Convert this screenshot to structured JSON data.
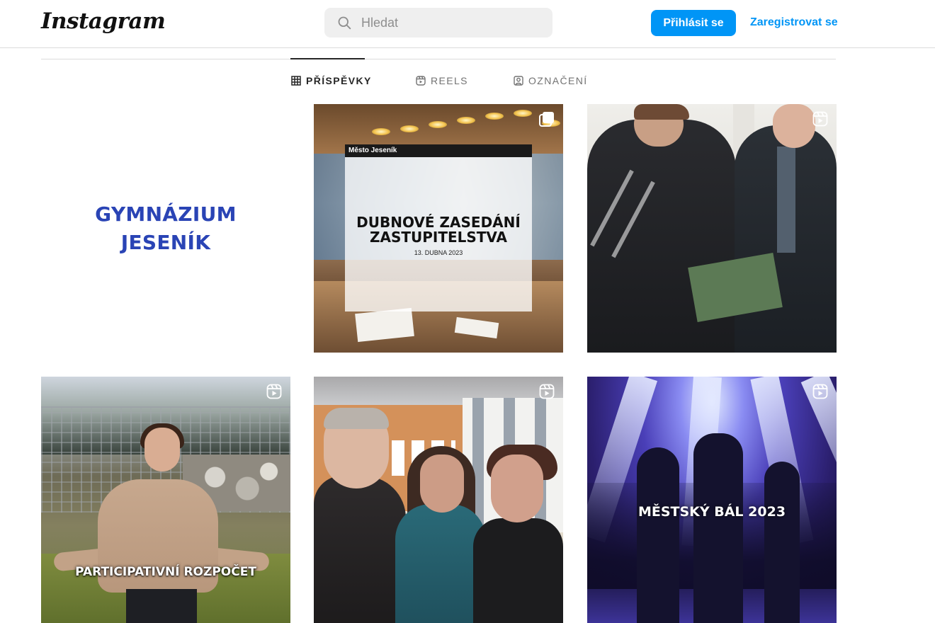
{
  "header": {
    "logo_text": "Instagram",
    "search_placeholder": "Hledat",
    "login_label": "Přihlásit se",
    "signup_label": "Zaregistrovat se"
  },
  "tabs": [
    {
      "label": "PŘÍSPĚVKY",
      "icon": "grid-icon",
      "active": true
    },
    {
      "label": "REELS",
      "icon": "reels-icon",
      "active": false
    },
    {
      "label": "OZNAČENÍ",
      "icon": "tagged-icon",
      "active": false
    }
  ],
  "posts": [
    {
      "kind": "image",
      "text_lines": [
        "GYMNÁZIUM",
        "JESENÍK"
      ],
      "badge": "none"
    },
    {
      "kind": "image",
      "header_text": "Město Jeseník",
      "title_lines": [
        "DUBNOVÉ ZASEDÁNÍ",
        "ZASTUPITELSTVA"
      ],
      "date_text": "13. DUBNA 2023",
      "badge": "carousel-icon"
    },
    {
      "kind": "video",
      "badge": "reel-icon"
    },
    {
      "kind": "video",
      "caption": "PARTICIPATIVNÍ ROZPOČET",
      "badge": "reel-icon"
    },
    {
      "kind": "video",
      "badge": "reel-icon"
    },
    {
      "kind": "video",
      "caption": "MĚSTSKÝ BÁL 2023",
      "badge": "reel-icon"
    }
  ],
  "colors": {
    "accent": "#0095f6",
    "search_bg": "#efefef",
    "gymnazium_blue": "#2a44b5"
  }
}
